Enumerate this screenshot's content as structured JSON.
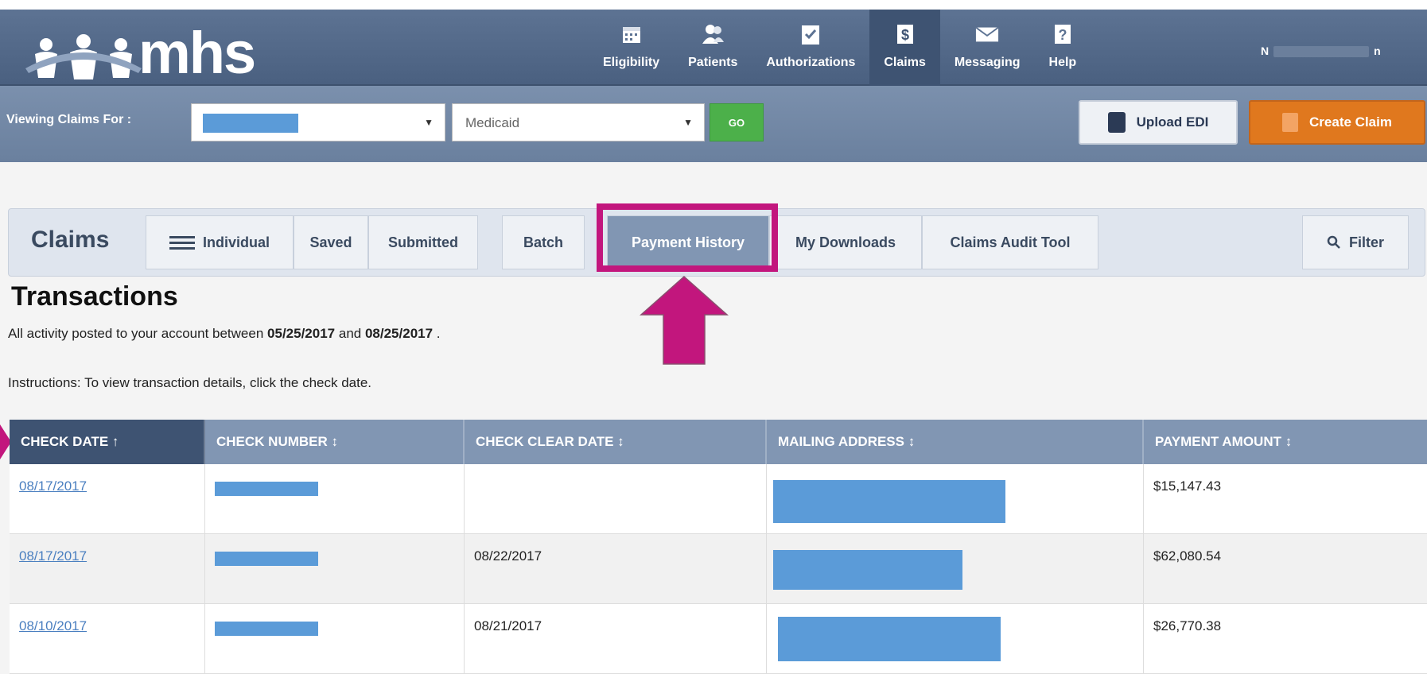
{
  "logo": {
    "text": "mhs"
  },
  "nav": [
    {
      "label": "Eligibility",
      "icon": "calendar-icon"
    },
    {
      "label": "Patients",
      "icon": "users-icon"
    },
    {
      "label": "Authorizations",
      "icon": "clipboard-check-icon"
    },
    {
      "label": "Claims",
      "icon": "dollar-doc-icon",
      "active": true
    },
    {
      "label": "Messaging",
      "icon": "envelope-icon"
    },
    {
      "label": "Help",
      "icon": "help-icon"
    }
  ],
  "user": {
    "initial": "N",
    "suffix": "n"
  },
  "filter": {
    "label": "Viewing Claims For :",
    "plan_value": "Medicaid",
    "go_label": "GO",
    "upload_label": "Upload EDI",
    "create_label": "Create Claim"
  },
  "claims_nav": {
    "title": "Claims",
    "tabs": [
      "Individual",
      "Saved",
      "Submitted",
      "Batch",
      "Payment History",
      "My Downloads",
      "Claims Audit Tool"
    ],
    "active_tab": "Payment History",
    "filter_label": "Filter"
  },
  "transactions": {
    "title": "Transactions",
    "desc_prefix": "All activity posted to your account between",
    "start_date": "05/25/2017",
    "desc_and": "and",
    "end_date": "08/25/2017",
    "desc_suffix": ".",
    "instructions": "Instructions: To view transaction details, click the check date."
  },
  "table": {
    "columns": [
      "CHECK DATE ↑",
      "CHECK NUMBER ↕",
      "CHECK CLEAR DATE ↕",
      "MAILING ADDRESS ↕",
      "PAYMENT AMOUNT ↕"
    ],
    "rows": [
      {
        "check_date": "08/17/2017",
        "clear_date": "",
        "amount": "$15,147.43"
      },
      {
        "check_date": "08/17/2017",
        "clear_date": "08/22/2017",
        "amount": "$62,080.54"
      },
      {
        "check_date": "08/10/2017",
        "clear_date": "08/21/2017",
        "amount": "$26,770.38"
      }
    ]
  },
  "colors": {
    "highlight": "#c2167d",
    "redaction": "#5b9bd8",
    "nav_bg": "#4a6080",
    "create_btn": "#e0781e",
    "go_btn": "#4cb04a"
  }
}
